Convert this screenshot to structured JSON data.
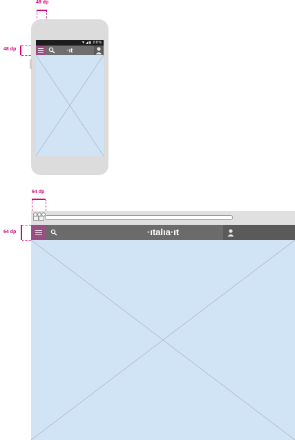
{
  "phone": {
    "width_label": "48 dp",
    "height_label": "48 dp",
    "status_icons": "▼◢▮ 88%",
    "logo": "·ıt"
  },
  "browser": {
    "width_label": "64 dp",
    "height_label": "64 dp",
    "logo": "·ıtalıa·ıt"
  },
  "colors": {
    "accent": "#d6007f",
    "menu": "#9a4f84",
    "toolbar": "#6e6e6e",
    "content": "#d1e4f6",
    "device": "#dcdcdc"
  }
}
